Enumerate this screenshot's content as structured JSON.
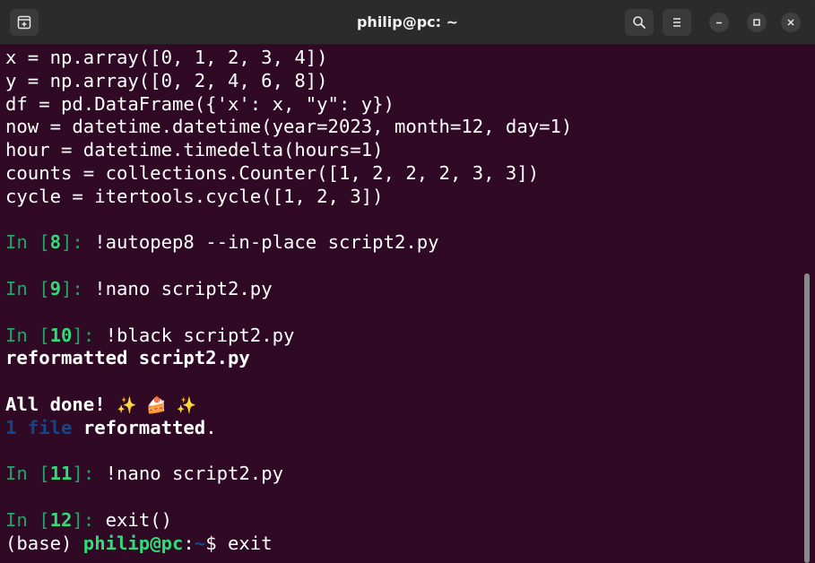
{
  "window": {
    "title": "philip@pc: ~"
  },
  "terminal": {
    "lines": [
      {
        "segments": [
          {
            "text": "x = np.array([0, 1, 2, 3, 4])",
            "style": "plain"
          }
        ]
      },
      {
        "segments": [
          {
            "text": "y = np.array([0, 2, 4, 6, 8])",
            "style": "plain"
          }
        ]
      },
      {
        "segments": [
          {
            "text": "df = pd.DataFrame({'x': x, \"y\": y})",
            "style": "plain"
          }
        ]
      },
      {
        "segments": [
          {
            "text": "now = datetime.datetime(year=2023, month=12, day=1)",
            "style": "plain"
          }
        ]
      },
      {
        "segments": [
          {
            "text": "hour = datetime.timedelta(hours=1)",
            "style": "plain"
          }
        ]
      },
      {
        "segments": [
          {
            "text": "counts = collections.Counter([1, 2, 2, 2, 3, 3])",
            "style": "plain"
          }
        ]
      },
      {
        "segments": [
          {
            "text": "cycle = itertools.cycle([1, 2, 3])",
            "style": "plain"
          }
        ]
      },
      {
        "segments": []
      },
      {
        "segments": [
          {
            "text": "In [",
            "style": "green"
          },
          {
            "text": "8",
            "style": "bgreen"
          },
          {
            "text": "]: ",
            "style": "green"
          },
          {
            "text": "!autopep8 --in-place script2.py",
            "style": "plain"
          }
        ]
      },
      {
        "segments": []
      },
      {
        "segments": [
          {
            "text": "In [",
            "style": "green"
          },
          {
            "text": "9",
            "style": "bgreen"
          },
          {
            "text": "]: ",
            "style": "green"
          },
          {
            "text": "!nano script2.py",
            "style": "plain"
          }
        ]
      },
      {
        "segments": []
      },
      {
        "segments": [
          {
            "text": "In [",
            "style": "green"
          },
          {
            "text": "10",
            "style": "bgreen"
          },
          {
            "text": "]: ",
            "style": "green"
          },
          {
            "text": "!black script2.py",
            "style": "plain"
          }
        ]
      },
      {
        "segments": [
          {
            "text": "reformatted script2.py",
            "style": "bold"
          }
        ]
      },
      {
        "segments": []
      },
      {
        "segments": [
          {
            "text": "All done! ",
            "style": "bold"
          },
          {
            "text": "✨ 🍰 ✨",
            "style": "emoji"
          }
        ]
      },
      {
        "segments": [
          {
            "text": "1 file",
            "style": "blue"
          },
          {
            "text": " ",
            "style": "plain"
          },
          {
            "text": "reformatted",
            "style": "bold"
          },
          {
            "text": ".",
            "style": "plain"
          }
        ]
      },
      {
        "segments": []
      },
      {
        "segments": [
          {
            "text": "In [",
            "style": "green"
          },
          {
            "text": "11",
            "style": "bgreen"
          },
          {
            "text": "]: ",
            "style": "green"
          },
          {
            "text": "!nano script2.py",
            "style": "plain"
          }
        ]
      },
      {
        "segments": []
      },
      {
        "segments": [
          {
            "text": "In [",
            "style": "green"
          },
          {
            "text": "12",
            "style": "bgreen"
          },
          {
            "text": "]: ",
            "style": "green"
          },
          {
            "text": "exit()",
            "style": "plain"
          }
        ]
      },
      {
        "segments": [
          {
            "text": "(base) ",
            "style": "plain"
          },
          {
            "text": "philip@pc",
            "style": "bgreen"
          },
          {
            "text": ":",
            "style": "plain"
          },
          {
            "text": "~",
            "style": "blue"
          },
          {
            "text": "$ exit",
            "style": "plain"
          }
        ]
      }
    ]
  },
  "icons": {
    "new_tab": "new-tab-icon",
    "search": "search-icon",
    "menu": "hamburger-menu-icon",
    "minimize": "minimize-icon",
    "maximize": "maximize-icon",
    "close": "close-icon"
  },
  "colors": {
    "background": "#300a24",
    "titlebar": "#2b2b2b",
    "prompt_green": "#26a269",
    "bright_green": "#33da7a",
    "blue": "#12488b",
    "text": "#ffffff"
  }
}
